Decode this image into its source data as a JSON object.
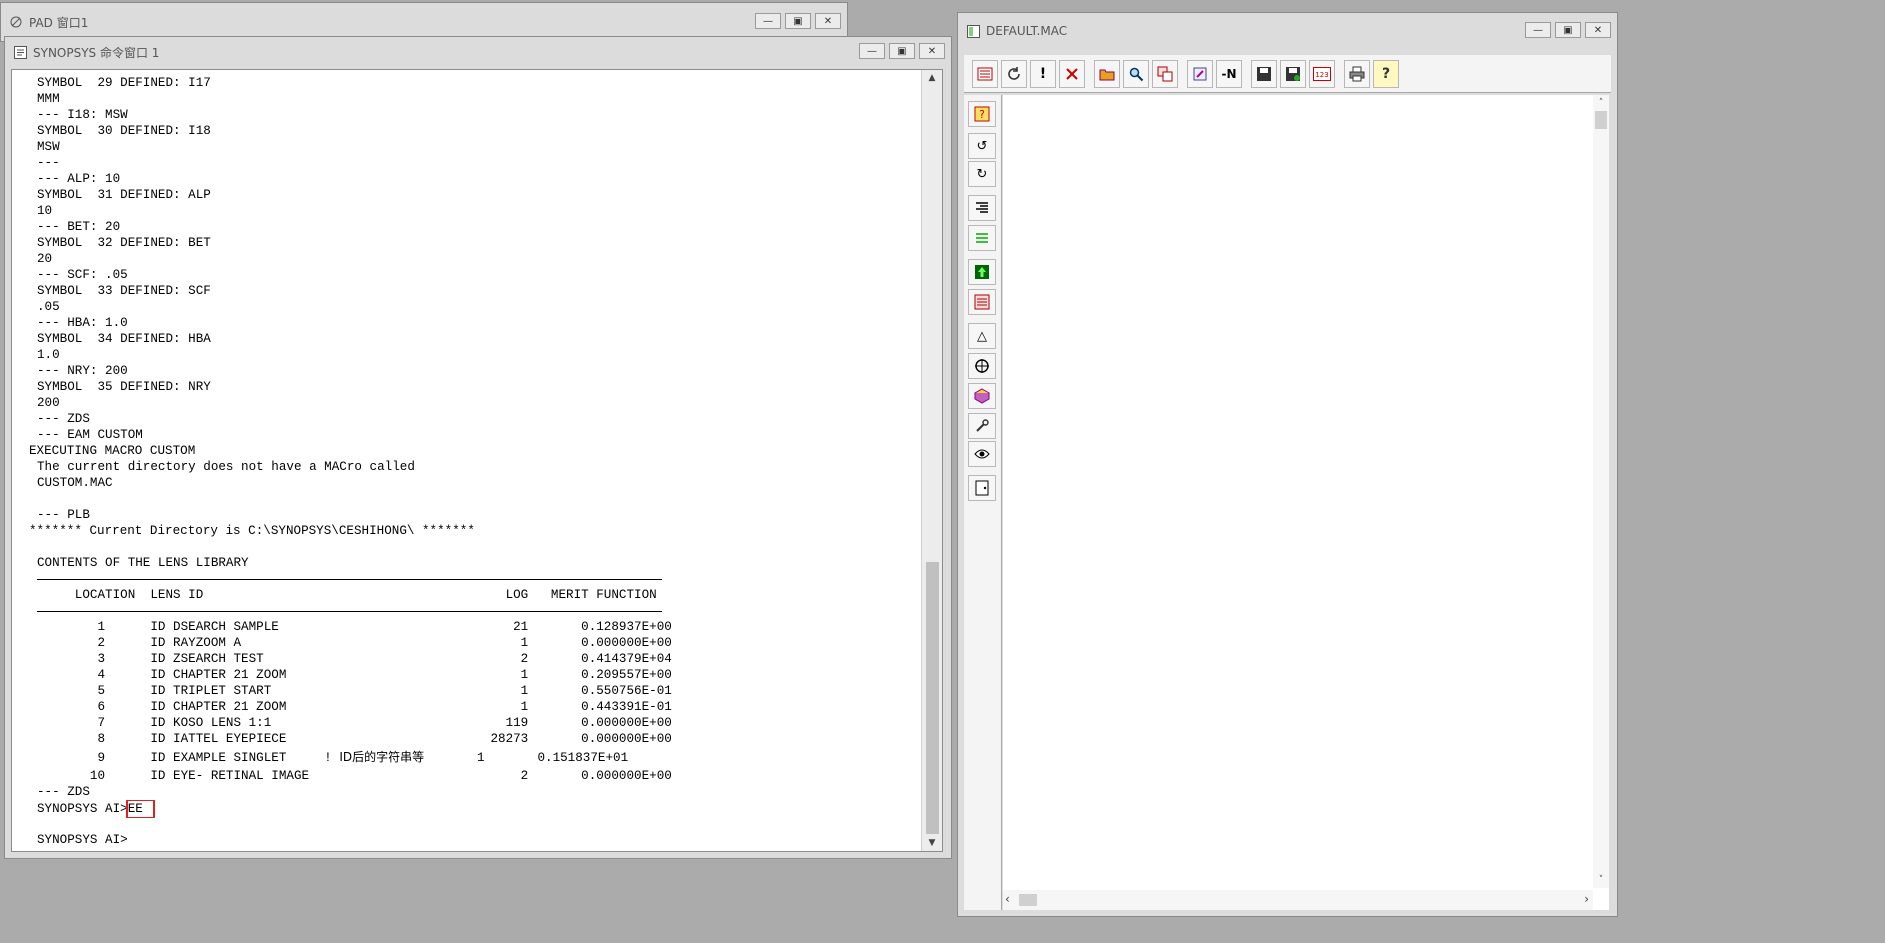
{
  "pad_window": {
    "title": "PAD 窗口1"
  },
  "command_window": {
    "title": "SYNOPSYS 命令窗口 1",
    "lines": [
      "SYMBOL  29 DEFINED: I17",
      "MMM",
      "--- I18: MSW",
      "SYMBOL  30 DEFINED: I18",
      "MSW",
      "---",
      "--- ALP: 10",
      "SYMBOL  31 DEFINED: ALP",
      "10",
      "--- BET: 20",
      "SYMBOL  32 DEFINED: BET",
      "20",
      "--- SCF: .05",
      "SYMBOL  33 DEFINED: SCF",
      ".05",
      "--- HBA: 1.0",
      "SYMBOL  34 DEFINED: HBA",
      "1.0",
      "--- NRY: 200",
      "SYMBOL  35 DEFINED: NRY",
      "200",
      "--- ZDS",
      "--- EAM CUSTOM",
      "EXECUTING MACRO CUSTOM",
      "The current directory does not have a MACro called",
      "CUSTOM.MAC",
      "",
      "--- PLB",
      "******* Current Directory is C:\\SYNOPSYS\\CESHIHONG\\ *******",
      "",
      "CONTENTS OF THE LENS LIBRARY"
    ],
    "table_header": "     LOCATION  LENS ID                                        LOG   MERIT FUNCTION",
    "table_rows": [
      "        1      ID DSEARCH SAMPLE                               21       0.128937E+00",
      "        2      ID RAYZOOM A                                     1       0.000000E+00",
      "        3      ID ZSEARCH TEST                                  2       0.414379E+04",
      "        4      ID CHAPTER 21 ZOOM                               1       0.209557E+00",
      "        5      ID TRIPLET START                                 1       0.550756E-01",
      "        6      ID CHAPTER 21 ZOOM                               1       0.443391E-01",
      "        7      ID KOSO LENS 1:1                               119       0.000000E+00",
      "        8      ID IATTEL EYEPIECE                           28273       0.000000E+00"
    ],
    "row9_prefix": "        9      ID EXAMPLE SINGLET     ! ",
    "row9_comment": "ID后的字符串等",
    "row9_suffix": "       1       0.151837E+01",
    "row10": "       10      ID EYE- RETINAL IMAGE                            2       0.000000E+00",
    "after_lines": [
      "--- ZDS"
    ],
    "prompt_label": "SYNOPSYS AI>",
    "prompt_input": "EE",
    "final_prompt": "SYNOPSYS AI>"
  },
  "editor_window": {
    "title": "DEFAULT.MAC"
  }
}
